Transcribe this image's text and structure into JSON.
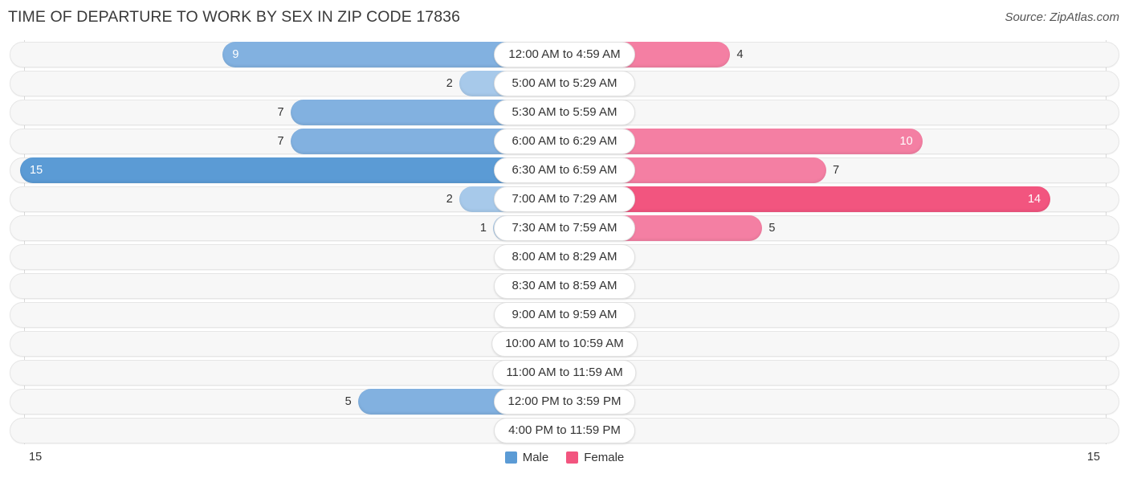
{
  "title": "TIME OF DEPARTURE TO WORK BY SEX IN ZIP CODE 17836",
  "source": "Source: ZipAtlas.com",
  "axis": {
    "left_tick": "15",
    "right_tick": "15"
  },
  "legend": {
    "items": [
      {
        "label": "Male",
        "color": "#5B9BD5"
      },
      {
        "label": "Female",
        "color": "#F2557F"
      }
    ]
  },
  "colors": {
    "male_max": "#5B9BD5",
    "male_mid": "#82B1E0",
    "male_min": "#A7C9EA",
    "female_max": "#F2557F",
    "female_mid": "#F47FA3",
    "female_min": "#F4A7C0",
    "track": "#f7f7f7",
    "track_border": "#e6e6e6"
  },
  "chart_data": {
    "type": "bar",
    "subtype": "diverging-bidirectional",
    "title": "TIME OF DEPARTURE TO WORK BY SEX IN ZIP CODE 17836",
    "xlabel": "",
    "ylabel": "",
    "xlim": [
      15,
      15
    ],
    "grid": false,
    "legend_position": "bottom-center",
    "categories": [
      "12:00 AM to 4:59 AM",
      "5:00 AM to 5:29 AM",
      "5:30 AM to 5:59 AM",
      "6:00 AM to 6:29 AM",
      "6:30 AM to 6:59 AM",
      "7:00 AM to 7:29 AM",
      "7:30 AM to 7:59 AM",
      "8:00 AM to 8:29 AM",
      "8:30 AM to 8:59 AM",
      "9:00 AM to 9:59 AM",
      "10:00 AM to 10:59 AM",
      "11:00 AM to 11:59 AM",
      "12:00 PM to 3:59 PM",
      "4:00 PM to 11:59 PM"
    ],
    "series": [
      {
        "name": "Male",
        "direction": "left",
        "color": "#5B9BD5",
        "values": [
          9,
          2,
          7,
          7,
          15,
          2,
          1,
          0,
          0,
          0,
          0,
          0,
          5,
          0
        ]
      },
      {
        "name": "Female",
        "direction": "right",
        "color": "#F2557F",
        "values": [
          4,
          0,
          0,
          10,
          7,
          14,
          5,
          0,
          0,
          0,
          0,
          0,
          0,
          0
        ]
      }
    ]
  }
}
